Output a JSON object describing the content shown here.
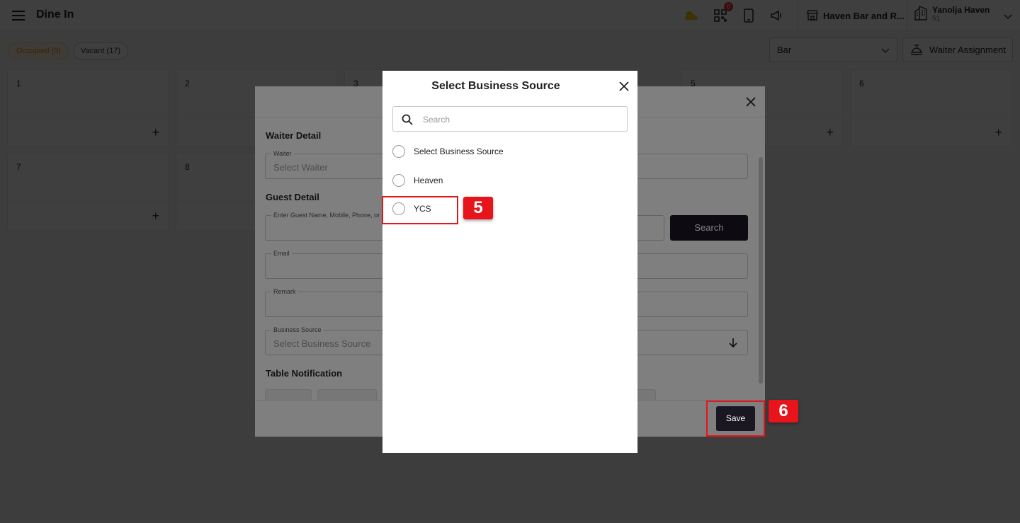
{
  "topbar": {
    "title": "Dine In",
    "notification_count": "0",
    "outlet_name": "Haven Bar and R...",
    "hotel_name": "Yanolja Haven",
    "hotel_code": "51"
  },
  "filters": {
    "occupied": "Occupied (0)",
    "vacant": "Vacant (17)"
  },
  "toolbar": {
    "area_select": "Bar",
    "waiter_assignment": "Waiter Assignment"
  },
  "tables": {
    "t1": "1",
    "t2": "2",
    "t3": "3",
    "t5": "5",
    "t6": "6",
    "t7": "7",
    "t8": "8"
  },
  "reservation": {
    "waiter_detail": "Waiter Detail",
    "waiter_label": "Waiter",
    "waiter_placeholder": "Select Waiter",
    "guest_detail": "Guest Detail",
    "guest_label": "Enter Guest Name, Mobile, Phone, or",
    "search_button": "Search",
    "email_label": "Email",
    "remark_label": "Remark",
    "business_source_label": "Business Source",
    "business_source_placeholder": "Select Business Source",
    "table_notification": "Table Notification",
    "save_button": "Save"
  },
  "business_source_modal": {
    "title": "Select Business Source",
    "search_placeholder": "Search",
    "options": [
      {
        "label": "Select Business Source",
        "selected": false
      },
      {
        "label": "Heaven",
        "selected": false
      },
      {
        "label": "YCS",
        "selected": false
      }
    ]
  },
  "annotations": {
    "step_5": "5",
    "step_6": "6",
    "color": "#e8141b"
  }
}
